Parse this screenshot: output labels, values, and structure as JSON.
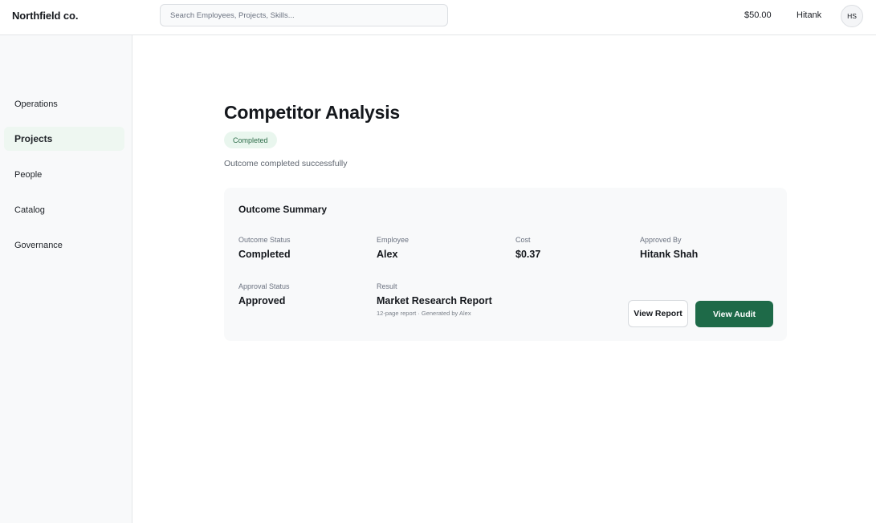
{
  "header": {
    "brand": "Northfield co.",
    "search_placeholder": "Search Employees, Projects, Skills...",
    "balance": "$50.00",
    "user_name": "Hitank",
    "user_initials": "HS"
  },
  "sidebar": {
    "items": [
      {
        "label": "Operations",
        "active": false
      },
      {
        "label": "Projects",
        "active": true
      },
      {
        "label": "People",
        "active": false
      },
      {
        "label": "Catalog",
        "active": false
      },
      {
        "label": "Governance",
        "active": false
      }
    ]
  },
  "page": {
    "title": "Competitor Analysis",
    "status": "Completed",
    "subtitle": "Outcome completed successfully"
  },
  "summary": {
    "title": "Outcome Summary",
    "outcome_status_label": "Outcome Status",
    "outcome_status_value": "Completed",
    "employee_label": "Employee",
    "employee_value": "Alex",
    "cost_label": "Cost",
    "cost_value": "$0.37",
    "approved_by_label": "Approved By",
    "approved_by_value": "Hitank Shah",
    "approval_status_label": "Approval Status",
    "approval_status_value": "Approved",
    "result_label": "Result",
    "result_value": "Market Research Report",
    "result_detail": "12-page report · Generated by Alex",
    "view_report_label": "View Report",
    "view_audit_label": "View Audit"
  },
  "colors": {
    "accent": "#1e6a48",
    "status_badge_bg": "#e9f6ee",
    "active_nav_bg": "#eef7f1"
  }
}
